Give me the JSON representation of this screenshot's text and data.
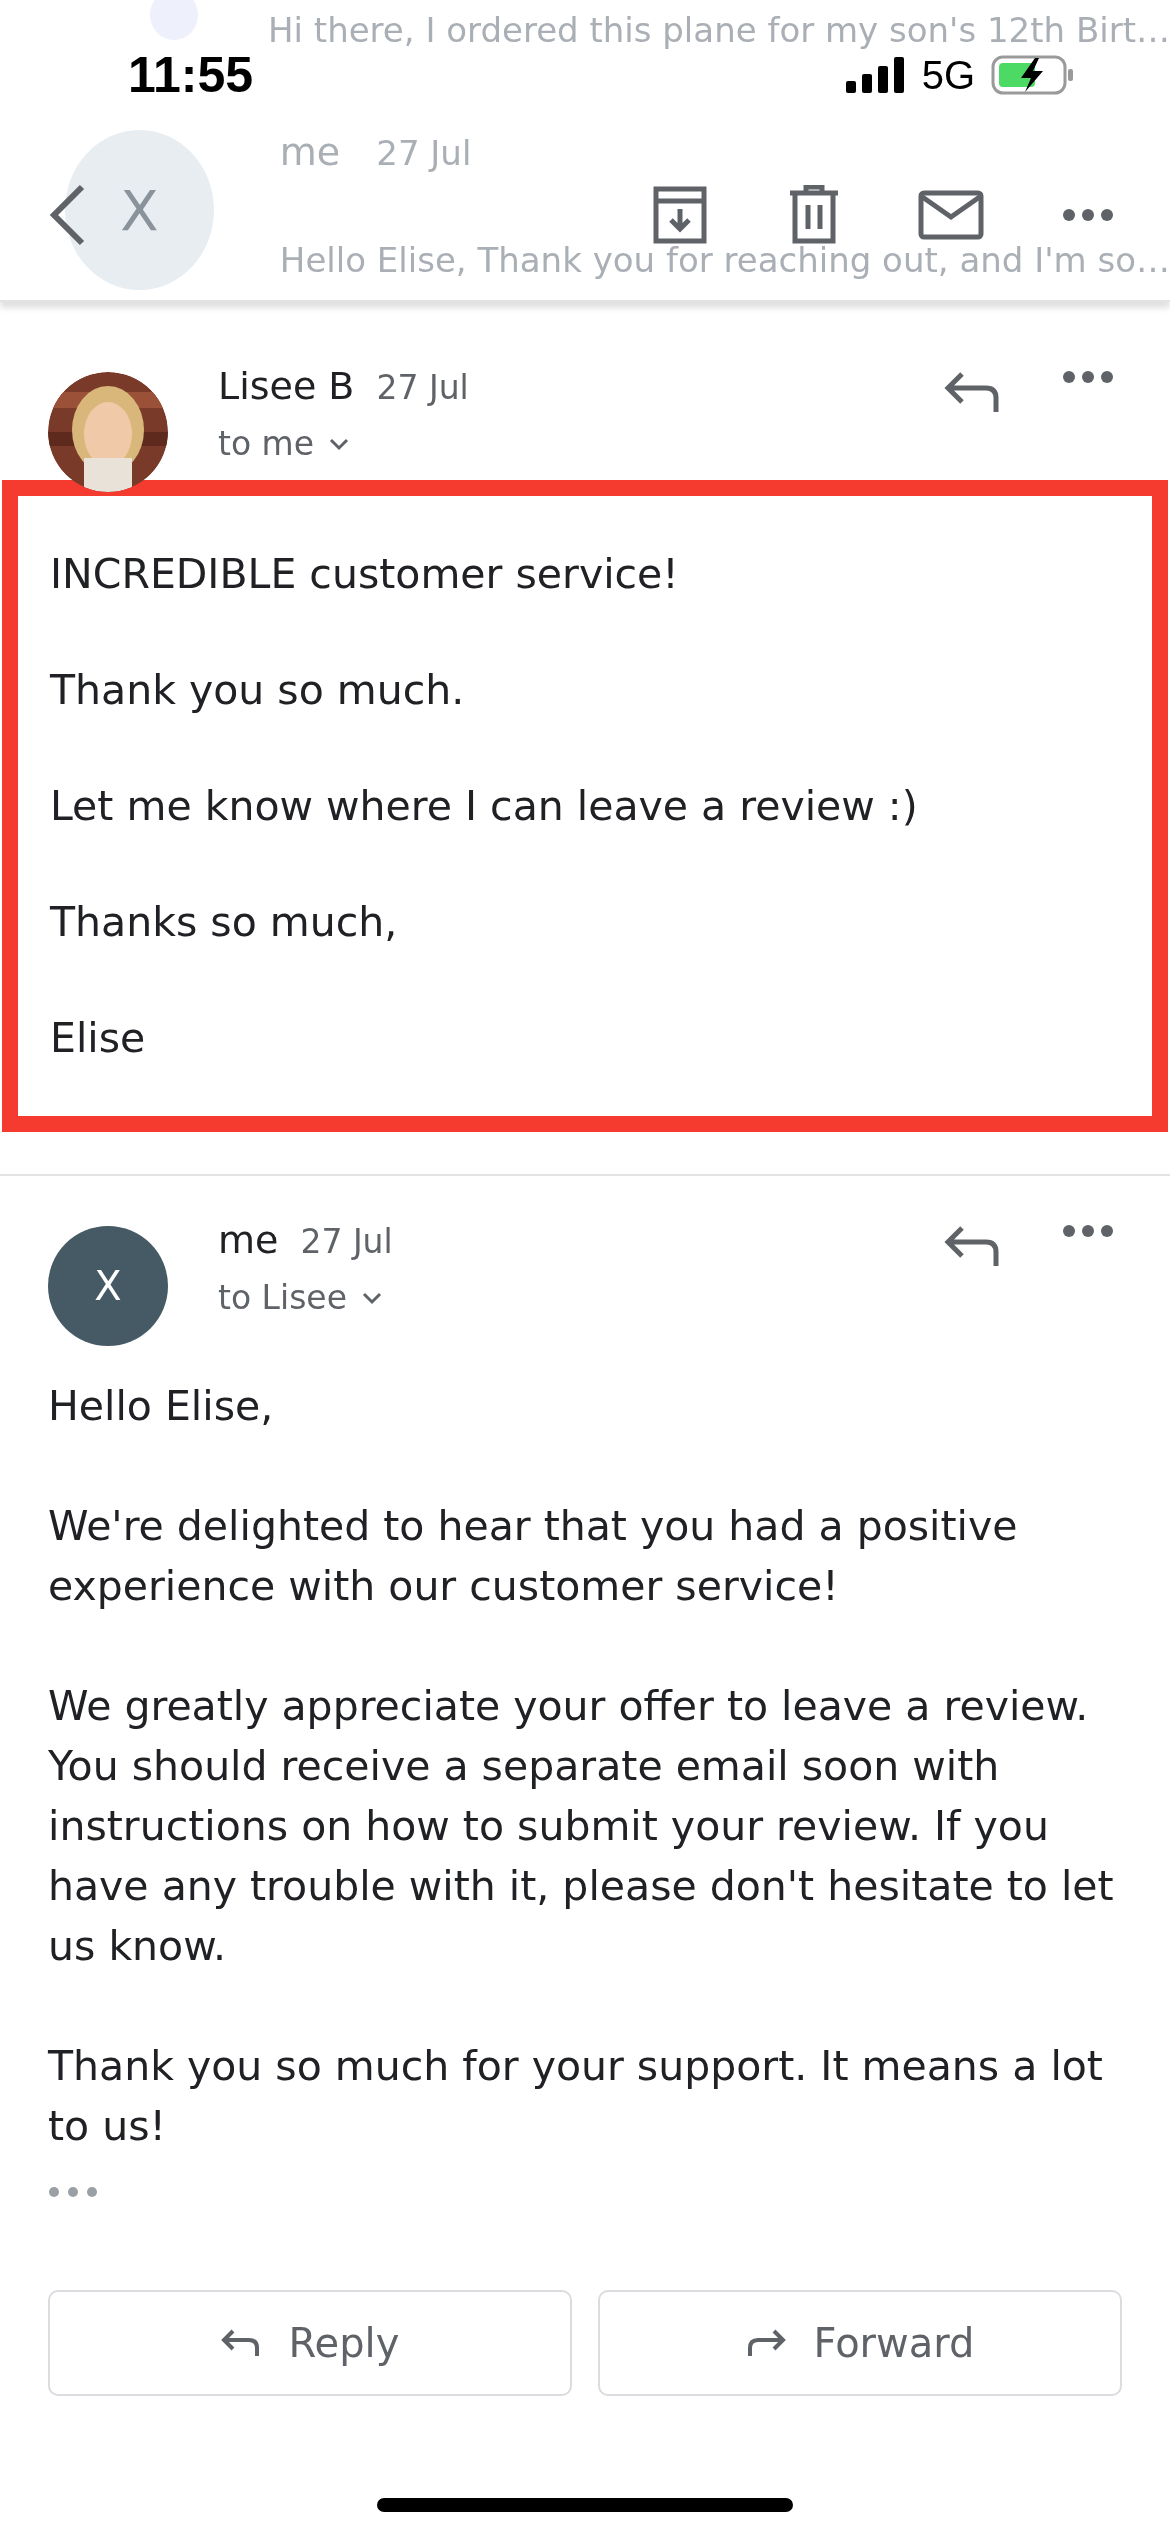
{
  "status_bar": {
    "time": "11:55",
    "network": "5G"
  },
  "behind_toolbar": [
    {
      "kind": "snippet",
      "text": "Hi there, I ordered this plane for my son's 12th Birt…"
    },
    {
      "kind": "message",
      "avatar_letter": "X",
      "sender": "me",
      "date": "27 Jul",
      "snippet": "Hello Elise, Thank you for reaching out, and I'm so…"
    }
  ],
  "messages": [
    {
      "kind": "photo_avatar",
      "sender": "Lisee B",
      "date": "27 Jul",
      "recipient": "to me",
      "highlighted": true,
      "paragraphs": [
        "INCREDIBLE customer service!",
        "Thank you so much.",
        "Let me know where I can leave a review :)",
        "Thanks so much,",
        "Elise"
      ],
      "trimmed": false
    },
    {
      "kind": "letter_avatar",
      "avatar_letter": "X",
      "sender": "me",
      "date": "27 Jul",
      "recipient": "to Lisee",
      "highlighted": false,
      "paragraphs": [
        "Hello Elise,",
        "We're delighted to hear that you had a positive experience with our customer service!",
        "We greatly appreciate your offer to leave a review. You should receive a separate email soon with instructions on how to submit your review. If you have any trouble with it, please don't hesitate to let us know.",
        "Thank you so much for your support. It means a lot to us!"
      ],
      "trimmed": true
    }
  ],
  "actions": [
    {
      "kind": "reply",
      "label": "Reply"
    },
    {
      "kind": "forward",
      "label": "Forward"
    }
  ]
}
